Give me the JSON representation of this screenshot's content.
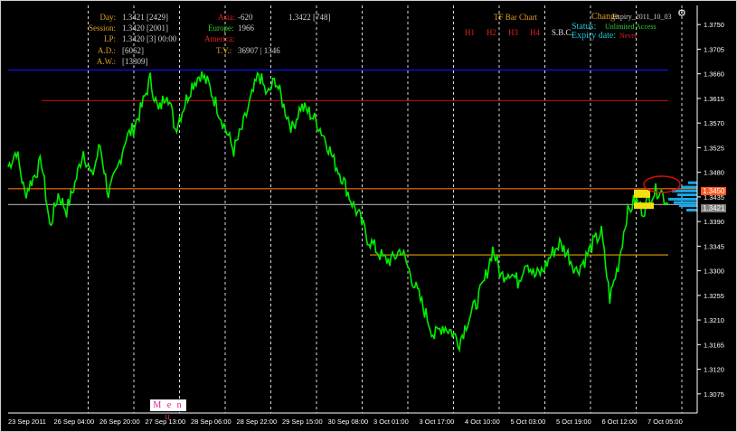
{
  "info_panel": {
    "day_label": "Day:",
    "day_value": "1.3421 [2429]",
    "session_label": "Session:",
    "session_value": "1.3420 [2001]",
    "lp_label": "LP:",
    "lp_value": "1.3420 [3] 00:00",
    "ad_label": "A.D.:",
    "ad_value": "[6062]",
    "aw_label": "A.W.:",
    "aw_value": "[13309]",
    "asia_label": "Asia:",
    "asia_value": "-620",
    "europe_label": "Europe:",
    "europe_value": "1966",
    "america_label": "America:",
    "tv_label": "T.V.:",
    "tv_value": "36907 | 1346",
    "price_count": "1.3422 [748]"
  },
  "tf_bar_chart": {
    "title": "TF Bar Chart",
    "items": [
      "H1",
      "H2",
      "H3",
      "H4"
    ],
    "sbc": "S.B.C."
  },
  "status_panel": {
    "change_label": "Change",
    "symbol": "Expiry_2011_10_03",
    "status_label": "Status:",
    "status_value": "Unlimited Access",
    "expiry_label": "Expiry date:",
    "expiry_value": "Never"
  },
  "menu_label": "M e n u",
  "price_badges": {
    "upper": "1.3450",
    "current": "1.3421"
  },
  "colors": {
    "background": "#000000",
    "price_line": "#00ee00",
    "blue_level": "#1010ff",
    "red_level": "#b81010",
    "orange_level": "#ff6a00",
    "gray_level": "#9a9a9a",
    "yellow_level": "#e0a000",
    "label_orange": "#e0a020",
    "label_red": "#e02020",
    "label_green": "#30d030",
    "label_cyan": "#20c0d0"
  },
  "chart_data": {
    "type": "line",
    "series": [
      {
        "values": [
          1.349,
          1.352,
          1.344,
          1.347,
          1.35,
          1.338,
          1.344,
          1.341,
          1.346,
          1.352,
          1.347,
          1.353,
          1.344,
          1.348,
          1.354,
          1.356,
          1.36,
          1.365,
          1.359,
          1.363,
          1.356,
          1.36,
          1.364,
          1.366,
          1.364,
          1.36,
          1.356,
          1.352,
          1.356,
          1.361,
          1.366,
          1.362,
          1.365,
          1.36,
          1.356,
          1.36,
          1.359,
          1.357,
          1.354,
          1.35,
          1.347,
          1.343,
          1.34,
          1.336,
          1.334,
          1.332,
          1.332,
          1.334,
          1.33,
          1.326,
          1.322,
          1.318,
          1.32,
          1.319,
          1.317,
          1.321,
          1.324,
          1.328,
          1.334,
          1.329,
          1.33,
          1.328,
          1.332,
          1.329,
          1.33,
          1.333,
          1.335,
          1.333,
          1.33,
          1.332,
          1.335,
          1.337,
          1.325,
          1.331,
          1.34,
          1.343,
          1.341,
          1.344,
          1.345,
          1.342
        ]
      }
    ],
    "x_tick_labels": [
      "23 Sep 2011",
      "26 Sep 04:00",
      "26 Sep 20:00",
      "27 Sep 13:00",
      "28 Sep 06:00",
      "28 Sep 22:00",
      "29 Sep 15:00",
      "30 Sep 08:00",
      "3 Oct 01:00",
      "3 Oct 17:00",
      "4 Oct 10:00",
      "5 Oct 03:00",
      "5 Oct 19:00",
      "6 Oct 12:00",
      "7 Oct 05:00"
    ],
    "y_ticks": [
      1.375,
      1.3705,
      1.366,
      1.3615,
      1.357,
      1.3525,
      1.348,
      1.3435,
      1.339,
      1.3345,
      1.33,
      1.3255,
      1.321,
      1.3165,
      1.312,
      1.3075
    ],
    "ylim": [
      1.304,
      1.3785
    ],
    "levels": [
      {
        "price": 1.3667,
        "color": "blue"
      },
      {
        "price": 1.3611,
        "color": "red"
      },
      {
        "price": 1.345,
        "color": "orange"
      },
      {
        "price": 1.3421,
        "color": "gray"
      },
      {
        "price": 1.3329,
        "color": "yellow"
      }
    ],
    "grid": true
  }
}
